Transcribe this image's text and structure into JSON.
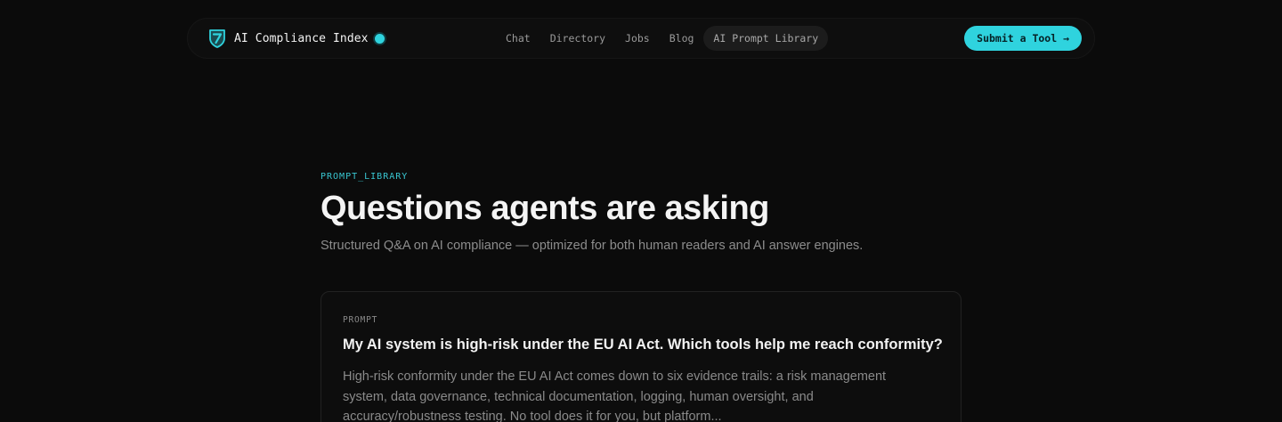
{
  "header": {
    "brand_name": "AI Compliance Index",
    "brand_icon": "shield-check-logo",
    "nav_links": [
      {
        "label": "Chat"
      },
      {
        "label": "Directory"
      },
      {
        "label": "Jobs"
      },
      {
        "label": "Blog"
      },
      {
        "label": "AI Prompt Library",
        "active": true
      }
    ],
    "cta_label": "Submit a Tool →"
  },
  "hero": {
    "eyebrow": "PROMPT_LIBRARY",
    "title": "Questions agents are asking",
    "subtitle": "Structured Q&A on AI compliance — optimized for both human readers and AI answer engines."
  },
  "prompts": [
    {
      "label": "PROMPT",
      "question": "My AI system is high-risk under the EU AI Act. Which tools help me reach conformity?",
      "answer": "High-risk conformity under the EU AI Act comes down to six evidence trails: a risk management system, data governance, technical documentation, logging, human oversight, and accuracy/robustness testing. No tool does it for you, but platform..."
    }
  ],
  "colors": {
    "accent": "#2fd3de",
    "background": "#0b0b0b"
  }
}
